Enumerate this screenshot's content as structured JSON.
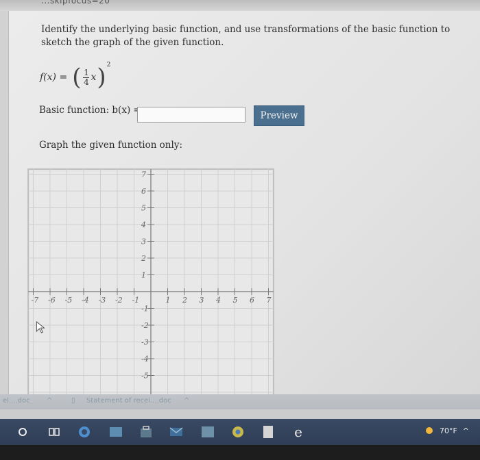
{
  "browser": {
    "url_fragment": "...skipfocus=20"
  },
  "question": {
    "instruction": "Identify the underlying basic function, and use transformations of the basic function to sketch the graph of the given function.",
    "function_name": "f(x) =",
    "fraction_numerator": "1",
    "fraction_denominator": "4",
    "variable": "x",
    "exponent": "2",
    "basic_function_label": "Basic function: b(x) =",
    "basic_function_value": "",
    "preview_label": "Preview",
    "graph_label": "Graph the given function only:"
  },
  "graph": {
    "x_tick_labels": [
      "-7",
      "-6",
      "-5",
      "-4",
      "-3",
      "-2",
      "-1",
      "1",
      "2",
      "3",
      "4",
      "5",
      "6",
      "7"
    ],
    "y_tick_labels": [
      "7",
      "6",
      "5",
      "4",
      "3",
      "2",
      "1",
      "-1",
      "-2",
      "-3",
      "-4",
      "-5"
    ],
    "x_range": [
      -7,
      7
    ],
    "y_range": [
      -6,
      7
    ]
  },
  "files": {
    "item1": "el....doc",
    "item2": "Statement of recei....doc"
  },
  "taskbar": {
    "temperature": "70°F"
  }
}
